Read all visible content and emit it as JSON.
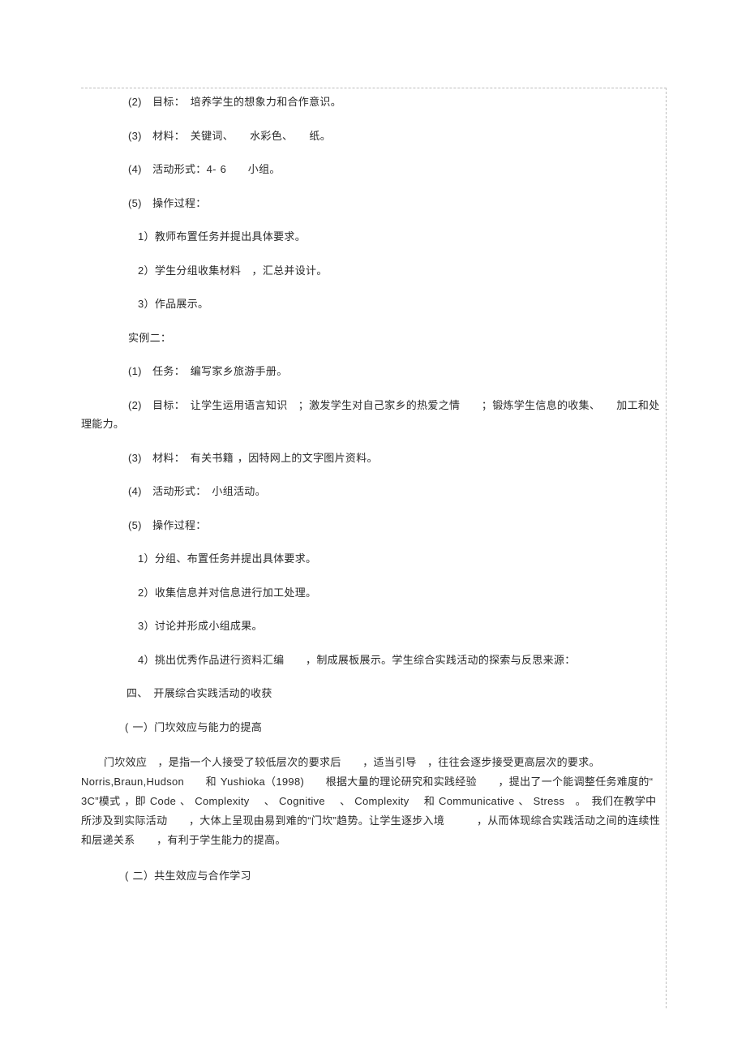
{
  "lines": {
    "l1": "(2)　目标：　培养学生的想象力和合作意识。",
    "l2": "(3)　材料：　关键词、　　水彩色、　　纸。",
    "l3": "(4)　活动形式：4- 6　　小组。",
    "l4": "(5)　操作过程：",
    "l5": "1）教师布置任务并提出具体要求。",
    "l6": "2）学生分组收集材料　，汇总并设计。",
    "l7": "3）作品展示。",
    "l8": "实例二：",
    "l9": "(1)　任务：　编写家乡旅游手册。",
    "l10a": "(2)　目标：　让学生运用语言知识　；激发学生对自己家乡的热爱之情　　；锻炼学生信息的收集、　　加工和处",
    "l10b": "理能力。",
    "l11": "(3)　材料：　有关书籍 ，因特网上的文字图片资料。",
    "l12": "(4)　活动形式：　小组活动。",
    "l13": "(5)　操作过程：",
    "l14": "1）分组、布置任务并提出具体要求。",
    "l15": "2）收集信息并对信息进行加工处理。",
    "l16": "3）讨论并形成小组成果。",
    "l17": "4）挑出优秀作品进行资料汇编　　，制成展板展示。学生综合实践活动的探索与反思来源：",
    "l18": "四、　开展综合实践活动的收获",
    "l19": "( 一）门坎效应与能力的提高",
    "l20": "门坎效应　，是指一个人接受了较低层次的要求后　　，适当引导　，往往会逐步接受更高层次的要求。Norris,Braun,Hudson　　和 Yushioka（1998)　　根据大量的理论研究和实践经验　　，提出了一个能调整任务难度的“ 3C”模式 ，即 Code 、 Complexity　 、 Cognitive　 、 Complexity　 和 Communicative 、 Stress　。　我们在教学中所涉及到实际活动　　，大体上呈现由易到难的“门坎”趋势。让学生逐步入境　　　，从而体现综合实践活动之间的连续性和层递关系　　，有利于学生能力的提高。",
    "l21": "( 二）共生效应与合作学习"
  }
}
